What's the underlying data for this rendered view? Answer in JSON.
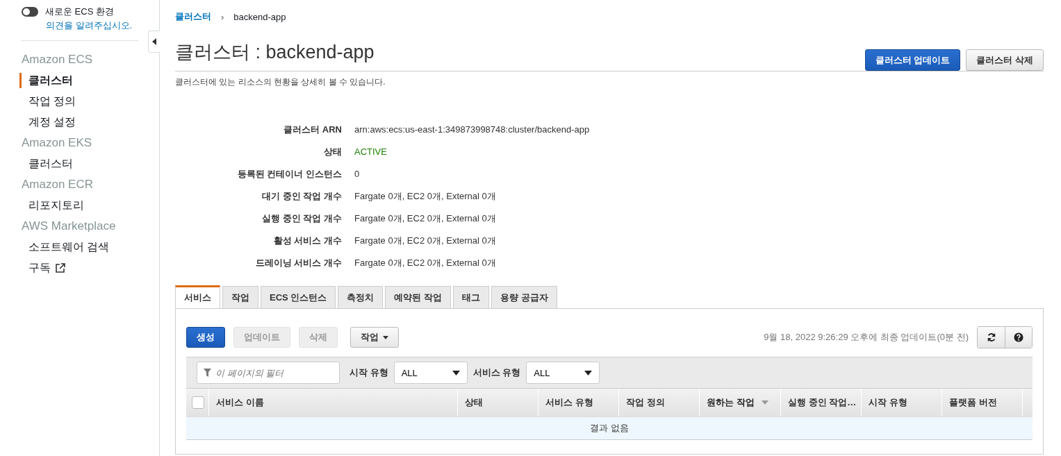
{
  "experience_toggle": {
    "label": "새로운 ECS 환경",
    "on": false,
    "link": "의견을 알려주십시오."
  },
  "sidebar": [
    {
      "heading": "Amazon ECS",
      "items": [
        {
          "label": "클러스터",
          "selected": true,
          "external": false
        },
        {
          "label": "작업 정의",
          "selected": false,
          "external": false
        },
        {
          "label": "계정 설정",
          "selected": false,
          "external": false
        }
      ]
    },
    {
      "heading": "Amazon EKS",
      "items": [
        {
          "label": "클러스터",
          "selected": false,
          "external": false
        }
      ]
    },
    {
      "heading": "Amazon ECR",
      "items": [
        {
          "label": "리포지토리",
          "selected": false,
          "external": false
        }
      ]
    },
    {
      "heading": "AWS Marketplace",
      "items": [
        {
          "label": "소프트웨어 검색",
          "selected": false,
          "external": false
        },
        {
          "label": "구독",
          "selected": false,
          "external": true
        }
      ]
    }
  ],
  "breadcrumb_separator": "›",
  "breadcrumb": [
    {
      "label": "클러스터",
      "kind": "link"
    },
    {
      "label": "backend-app",
      "kind": "current"
    }
  ],
  "page_title": "클러스터 : backend-app",
  "header_buttons": [
    {
      "label": "클러스터 업데이트",
      "kind": "primary"
    },
    {
      "label": "클러스터 삭제",
      "kind": "default"
    }
  ],
  "description": "클러스터에 있는 리소스의 현황을 상세히 볼 수 있습니다.",
  "details": [
    {
      "label": "클러스터 ARN",
      "value": "arn:aws:ecs:us-east-1:349873998748:cluster/backend-app",
      "kind": "text"
    },
    {
      "label": "상태",
      "value": "ACTIVE",
      "kind": "status"
    },
    {
      "label": "등록된 컨테이너 인스턴스",
      "value": "0",
      "kind": "text"
    },
    {
      "label": "대기 중인 작업 개수",
      "value": "Fargate 0개, EC2 0개, External 0개",
      "kind": "text"
    },
    {
      "label": "실행 중인 작업 개수",
      "value": "Fargate 0개, EC2 0개, External 0개",
      "kind": "text"
    },
    {
      "label": "활성 서비스 개수",
      "value": "Fargate 0개, EC2 0개, External 0개",
      "kind": "text"
    },
    {
      "label": "드레이닝 서비스 개수",
      "value": "Fargate 0개, EC2 0개, External 0개",
      "kind": "text"
    }
  ],
  "tabs": [
    {
      "label": "서비스",
      "selected": true
    },
    {
      "label": "작업",
      "selected": false
    },
    {
      "label": "ECS 인스턴스",
      "selected": false
    },
    {
      "label": "측정치",
      "selected": false
    },
    {
      "label": "예약된 작업",
      "selected": false
    },
    {
      "label": "태그",
      "selected": false
    },
    {
      "label": "용량 공급자",
      "selected": false
    }
  ],
  "toolbar_buttons": [
    {
      "label": "생성",
      "kind": "primary"
    },
    {
      "label": "업데이트",
      "kind": "disabled"
    },
    {
      "label": "삭제",
      "kind": "disabled"
    },
    {
      "label": "작업",
      "kind": "dropdown"
    }
  ],
  "last_updated": "9월 18, 2022 9:26:29 오후에 최종 업데이트(0분 전)",
  "filter": {
    "placeholder": "이 페이지의 필터"
  },
  "selects": [
    {
      "label": "시작 유형",
      "value": "ALL"
    },
    {
      "label": "서비스 유형",
      "value": "ALL"
    }
  ],
  "table": {
    "select_all_checked": false,
    "columns": [
      {
        "label": "서비스 이름",
        "sorted": false
      },
      {
        "label": "상태",
        "sorted": false
      },
      {
        "label": "서비스 유형",
        "sorted": false
      },
      {
        "label": "작업 정의",
        "sorted": false
      },
      {
        "label": "원하는 작업",
        "sorted": true
      },
      {
        "label": "실행 중인 작업…",
        "sorted": false
      },
      {
        "label": "시작 유형",
        "sorted": false
      },
      {
        "label": "플랫폼 버전",
        "sorted": false
      }
    ],
    "empty_message": "결과 없음"
  }
}
